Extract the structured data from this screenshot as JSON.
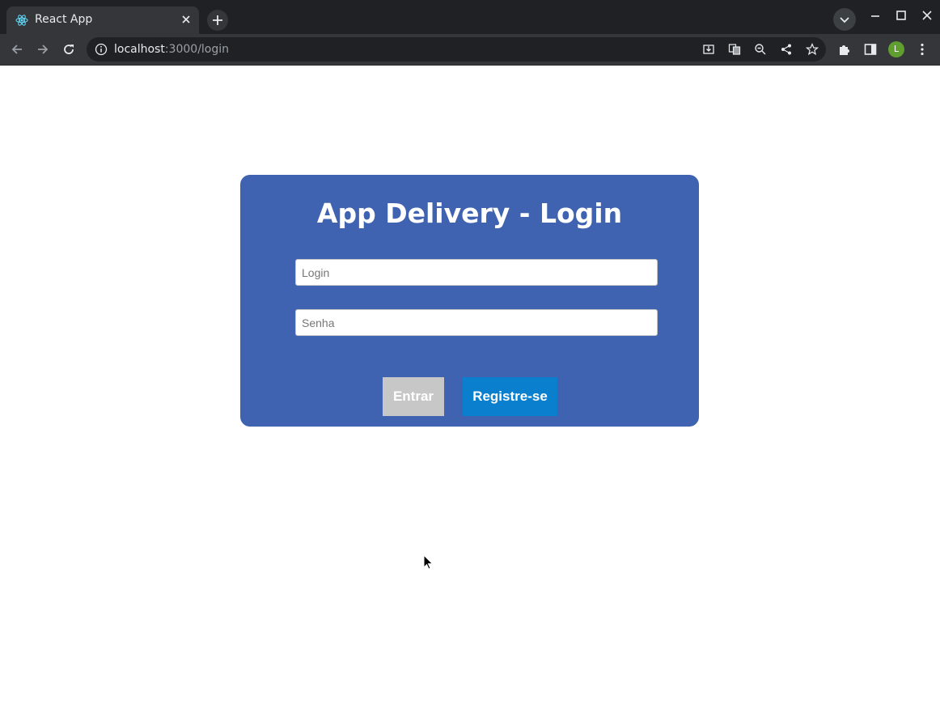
{
  "browser": {
    "tab_title": "React App",
    "url_host": "localhost",
    "url_path": ":3000/login",
    "profile_initial": "L"
  },
  "page": {
    "title": "App Delivery - Login",
    "login_placeholder": "Login",
    "password_placeholder": "Senha",
    "enter_label": "Entrar",
    "register_label": "Registre-se"
  },
  "colors": {
    "card_bg": "#3f63b0",
    "enter_bg": "#c7c7c7",
    "register_bg": "#0a7fce"
  },
  "icons": [
    "react-favicon-icon",
    "close-icon",
    "plus-icon",
    "chevron-down-icon",
    "minimize-icon",
    "maximize-icon",
    "window-close-icon",
    "back-icon",
    "forward-icon",
    "reload-icon",
    "info-icon",
    "install-icon",
    "translate-icon",
    "zoom-out-icon",
    "share-icon",
    "star-icon",
    "extensions-icon",
    "side-panel-icon",
    "menu-icon",
    "cursor-icon"
  ]
}
